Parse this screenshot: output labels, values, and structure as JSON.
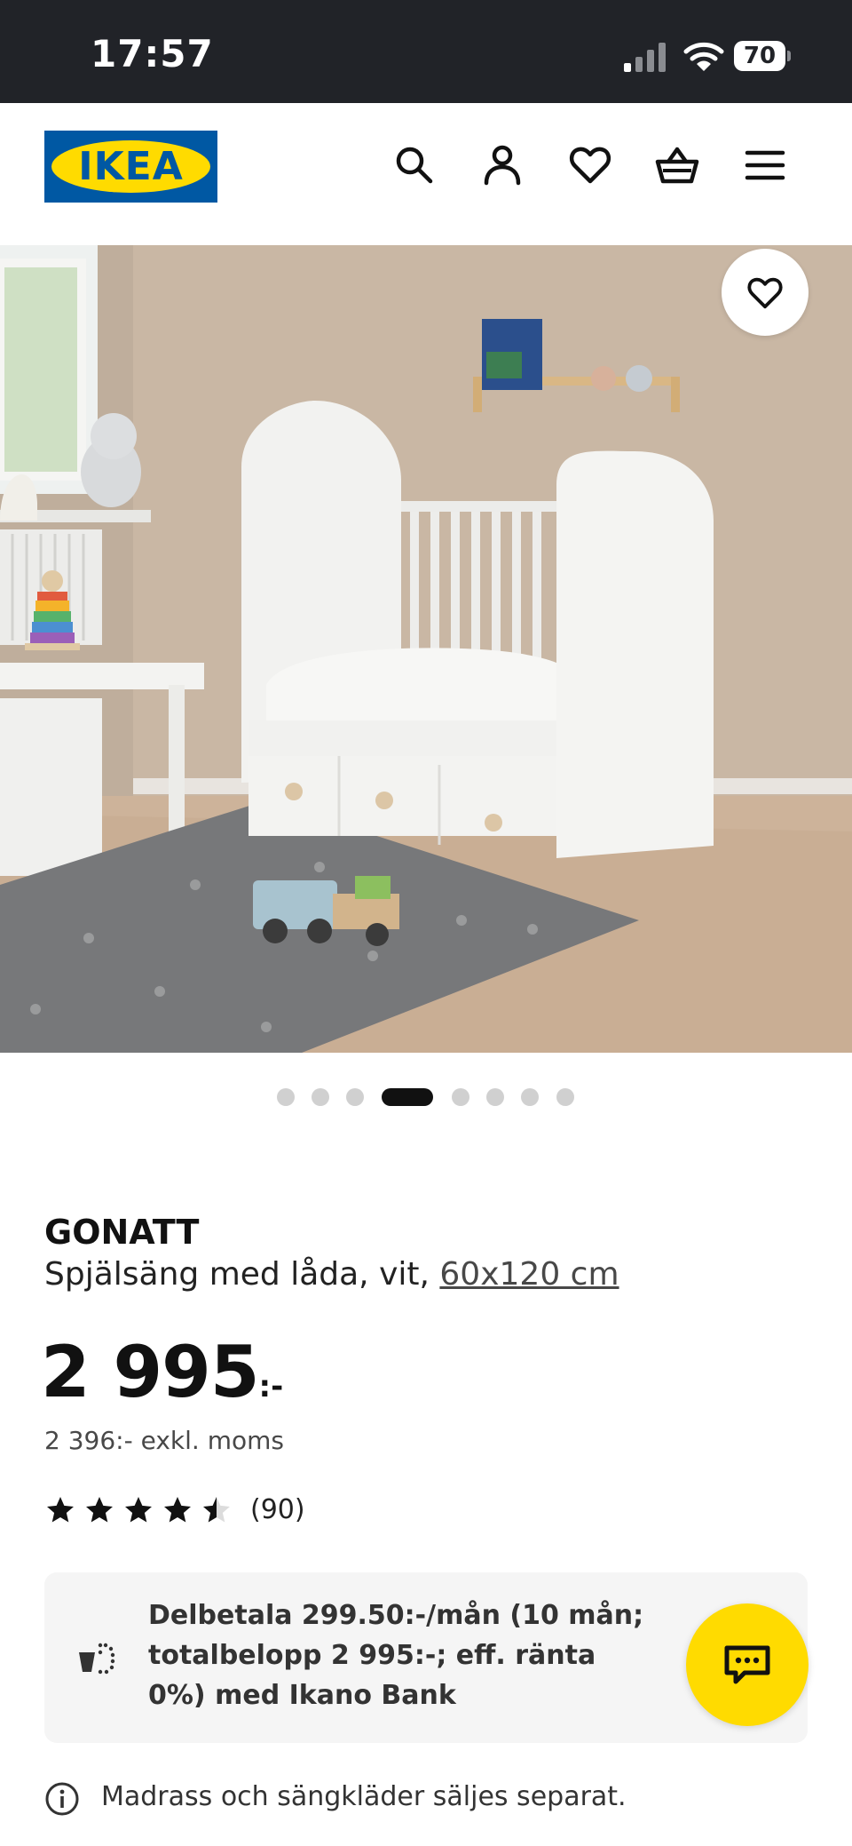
{
  "status_bar": {
    "time": "17:57",
    "battery": "70"
  },
  "header": {
    "logo_text": "IKEA",
    "icons": [
      "search-icon",
      "user-icon",
      "heart-icon",
      "cart-icon",
      "menu-icon"
    ]
  },
  "gallery": {
    "image_count": 8,
    "active_index": 3
  },
  "product": {
    "name": "GONATT",
    "description": "Spjälsäng med låda, vit,",
    "size": "60x120 cm",
    "price": "2 995",
    "price_suffix": ":-",
    "price_ex_vat": "2 396:- exkl. moms",
    "rating": 4.5,
    "rating_count": "(90)"
  },
  "finance": {
    "text": "Delbetala 299.50:-/mån (10 mån; totalbelopp 2 995:-; eff. ränta 0%) med Ikano Bank"
  },
  "note": {
    "text": "Madrass och sängkläder säljes separat."
  },
  "colors": {
    "ikea_blue": "#0058a3",
    "ikea_yellow": "#ffdb00",
    "status_bar_bg": "#212328"
  }
}
